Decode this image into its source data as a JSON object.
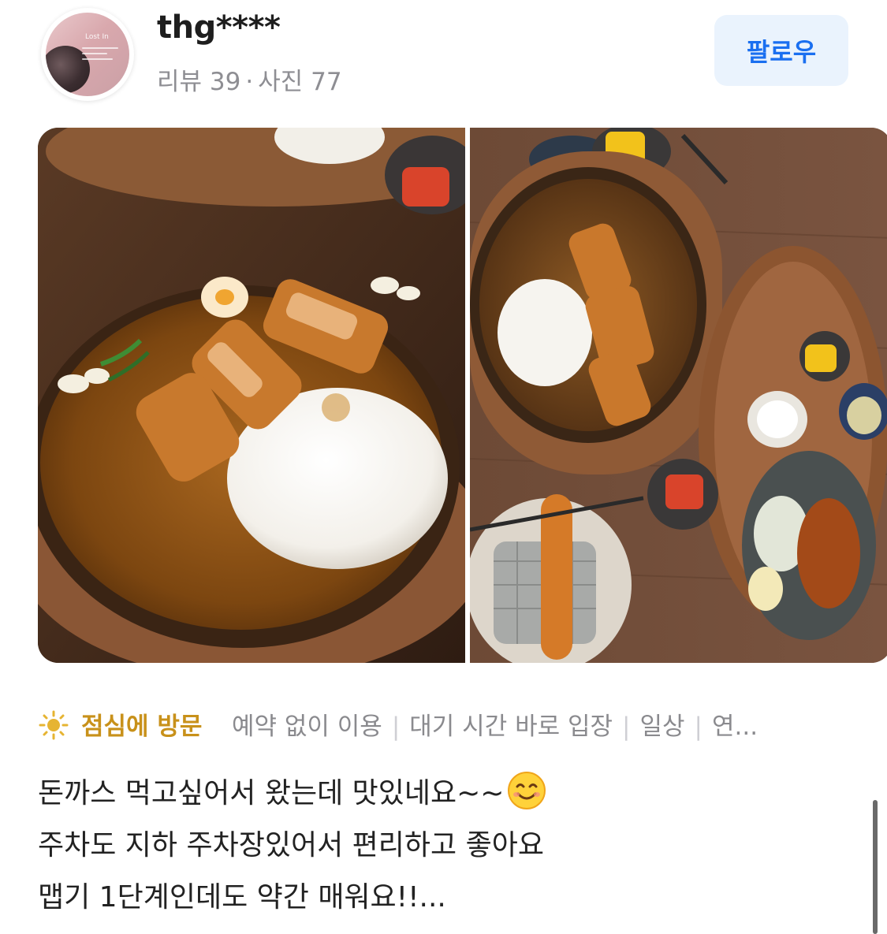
{
  "header": {
    "avatar_text": "Lost In",
    "username": "thg****",
    "reviews_label": "리뷰 39",
    "photos_label": "사진 77",
    "stats_separator": "·",
    "follow_label": "팔로우"
  },
  "photos": [
    {
      "description_icon": "photo-pork-cutlet-curry-closeup"
    },
    {
      "description_icon": "photo-table-overhead"
    }
  ],
  "tags": {
    "visit_time": "점심에 방문",
    "items": [
      "예약 없이 이용",
      "대기 시간 바로 입장",
      "일상",
      "연..."
    ],
    "separator": "|",
    "sun_icon": "sun-icon",
    "colors": {
      "visit": "#c8911a",
      "muted": "#8a8a8e"
    }
  },
  "review": {
    "lines": [
      "돈까스 먹고싶어서 왔는데 맛있네요~~",
      "주차도 지하 주차장있어서 편리하고 좋아요",
      "맵기 1단계인데도 약간 매워요!!..."
    ]
  },
  "colors": {
    "follow_bg": "#eaf3fd",
    "follow_text": "#1a6ff0",
    "text": "#222222",
    "muted": "#8e8e93"
  }
}
